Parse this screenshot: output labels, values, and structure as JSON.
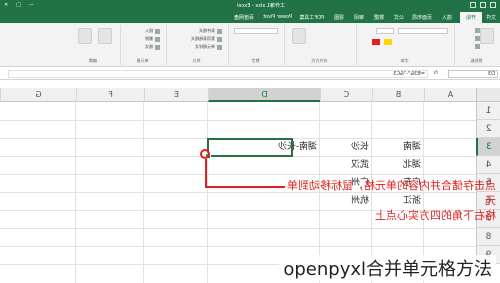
{
  "app": {
    "title": "工作簿1.xlsx - Excel",
    "window_buttons": [
      "—",
      "□",
      "✕"
    ]
  },
  "ribbon_tabs": [
    {
      "label": "文件",
      "active": false
    },
    {
      "label": "开始",
      "active": true
    },
    {
      "label": "插入",
      "active": false
    },
    {
      "label": "页面布局",
      "active": false
    },
    {
      "label": "公式",
      "active": false
    },
    {
      "label": "数据",
      "active": false
    },
    {
      "label": "审阅",
      "active": false
    },
    {
      "label": "视图",
      "active": false
    },
    {
      "label": "PDF工具集",
      "active": false
    },
    {
      "label": "Power Pivot",
      "active": false
    },
    {
      "label": "百度网盘",
      "active": false
    }
  ],
  "ribbon_groups": {
    "clipboard": "剪贴板",
    "font": "字体",
    "alignment": "对齐方式",
    "number": "数字",
    "styles": "样式",
    "cells": "单元格",
    "editing": "编辑"
  },
  "ribbon_labels": {
    "insert": "插入",
    "delete": "删除",
    "format": "格式",
    "cond_format": "条件格式",
    "table_format": "套用表格格式",
    "cell_style": "单元格样式"
  },
  "formula_bar": {
    "name_box": "D3",
    "fx": "fx",
    "formula": "=B3&\"-\"&C3"
  },
  "columns": [
    "A",
    "B",
    "C",
    "D",
    "E",
    "F",
    "G"
  ],
  "rows": [
    "1",
    "2",
    "3",
    "4",
    "5",
    "6",
    "7",
    "8",
    "9"
  ],
  "cells": {
    "B3": "湖南",
    "C3": "长沙",
    "D3": "湖南-长沙",
    "B4": "湖北",
    "C4": "武汉",
    "B5": "广东",
    "C5": "广州",
    "B6": "浙江",
    "C6": "杭州"
  },
  "annotation": {
    "line1": "点击存储合并内容的单元格，鼠标移动到单元",
    "line2": "格右下角的四方实心点上"
  },
  "caption": "openpyxl合并单元格方法",
  "colors": {
    "excel_green": "#217346",
    "annotation_red": "#e02020"
  }
}
